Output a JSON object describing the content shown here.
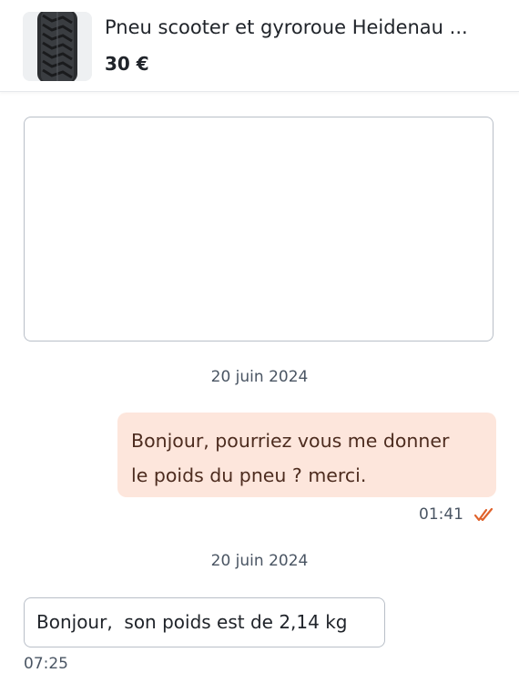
{
  "listing": {
    "title": "Pneu scooter et gyroroue Heidenau ...",
    "price": "30 €",
    "image_icon": "tire-thumbnail"
  },
  "messages": [
    {
      "date": "20 juin 2024",
      "direction": "outgoing",
      "text_lines": [
        "Bonjour, pourriez vous me donner",
        "le poids du pneu ? merci."
      ],
      "time": "01:41",
      "status_icon": "double-check-icon"
    },
    {
      "date": "20 juin 2024",
      "direction": "incoming",
      "text": "Bonjour,  son poids est de 2,14 kg",
      "time": "07:25"
    }
  ],
  "colors": {
    "outgoing_bubble": "#fde6dc",
    "read_tick": "#e0622b",
    "border": "#b9bfc8"
  }
}
